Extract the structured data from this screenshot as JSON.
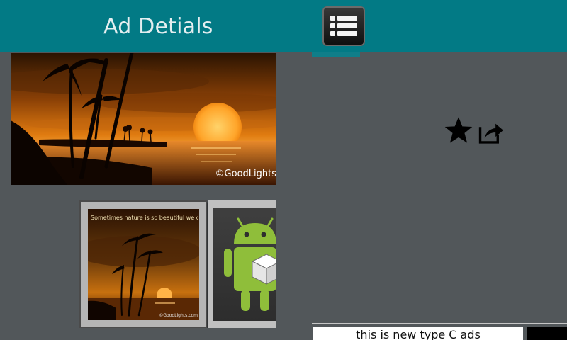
{
  "actionbar": {
    "title": "Ad Detials",
    "list_button_icon": "list-icon",
    "color": "#027a85"
  },
  "main_image": {
    "subject": "sunset-palm-trees",
    "watermark": "©GoodLights"
  },
  "gallery": {
    "thumbnails": [
      {
        "subject": "sunset-palm-trees",
        "caption": "Sometimes nature is so beautiful we can't explain",
        "watermark": "©GoodLights.com"
      },
      {
        "subject": "android-robot"
      }
    ]
  },
  "actions": {
    "favorite_icon": "star-icon",
    "share_icon": "share-icon"
  },
  "ad": {
    "text": "this is new type C ads"
  }
}
